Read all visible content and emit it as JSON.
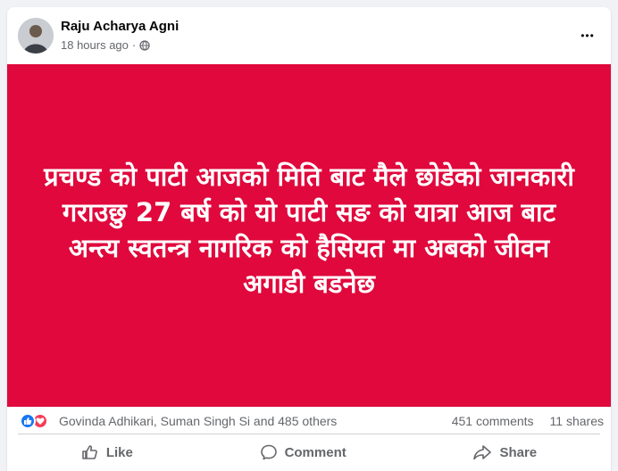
{
  "post": {
    "author": "Raju Acharya Agni",
    "time": "18 hours ago",
    "time_separator": "·",
    "more_label": "•••",
    "body_text": "प्रचण्ड को पाटी आजको मिति बाट मैले छोडेको जानकारी गराउछु 27 बर्ष को यो पाटी सङ को यात्रा आज बाट अन्त्य स्वतन्त्र नागरिक को हैसियत मा अबको जीवन अगाडी बडनेछ",
    "background_color": "#e0083c"
  },
  "reactions": {
    "icons": [
      "like-icon",
      "love-icon"
    ],
    "names": "Govinda Adhikari, Suman Singh Si and 485 others",
    "comments": "451 comments",
    "shares": "11 shares"
  },
  "actions": {
    "like": "Like",
    "comment": "Comment",
    "share": "Share"
  }
}
